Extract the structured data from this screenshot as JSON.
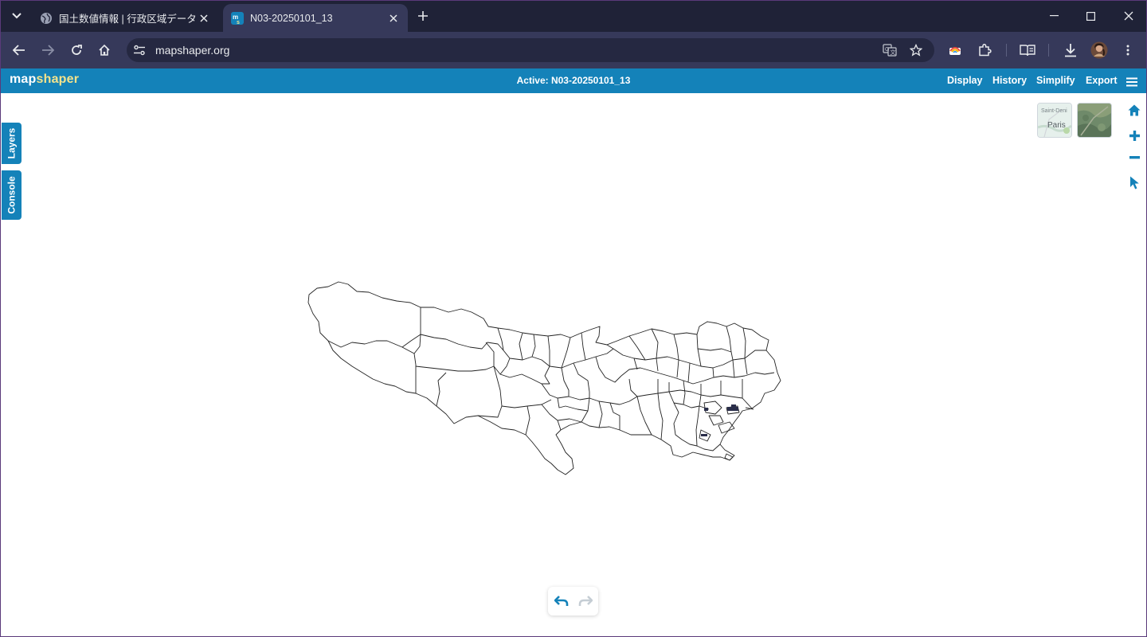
{
  "browser": {
    "tabs": [
      {
        "title": "国土数値情報 | 行政区域データ",
        "icon": "globe-icon",
        "active": false
      },
      {
        "title": "N03-20250101_13",
        "icon": "mapshaper-favicon",
        "active": true
      }
    ],
    "url": "mapshaper.org"
  },
  "app": {
    "logo_part1": "map",
    "logo_part2": "shaper",
    "active_label": "Active: N03-20250101_13",
    "menu": {
      "display": "Display",
      "history": "History",
      "simplify": "Simplify",
      "export": "Export"
    },
    "side_tabs": {
      "layers": "Layers",
      "console": "Console"
    },
    "basemaps": {
      "street_label_top": "Saint-Deni",
      "street_label_city": "Paris"
    }
  },
  "colors": {
    "accent": "#1482b9",
    "logo_highlight": "#f4e38c",
    "chrome_dark": "#1f2237",
    "chrome_toolbar": "#36395a"
  }
}
